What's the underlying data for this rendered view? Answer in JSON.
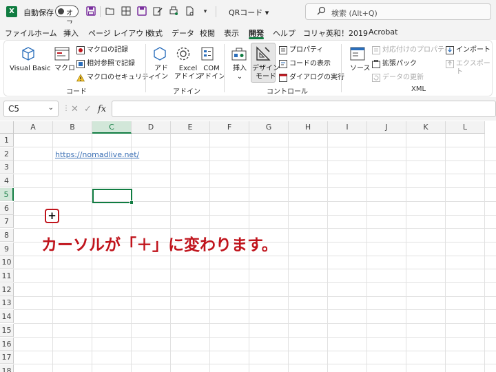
{
  "titlebar": {
    "app_logo": "X",
    "autosave_label": "自動保存",
    "autosave_state": "オフ",
    "doc_title": "QRコード ▾",
    "search_placeholder": "検索 (Alt+Q)",
    "qat_icons": [
      "save-icon",
      "open-icon",
      "table-icon",
      "save-as-icon",
      "edit-icon",
      "print-preview-icon",
      "document-icon",
      "dropdown-icon"
    ]
  },
  "tabs": [
    "ファイル",
    "ホーム",
    "挿入",
    "ページ レイアウト",
    "数式",
    "データ",
    "校閲",
    "表示",
    "開発",
    "ヘルプ",
    "コリャ英和！2019",
    "Acrobat"
  ],
  "active_tab": "開発",
  "ribbon": {
    "code": {
      "visual_basic": "Visual Basic",
      "macro": "マクロ",
      "record_macro": "マクロの記録",
      "relative_ref": "相対参照で記録",
      "macro_security": "マクロのセキュリティ",
      "label": "コード"
    },
    "addin": {
      "addin_1": "アド",
      "addin_2": "イン",
      "excel_1": "Excel",
      "excel_2": "アドイン",
      "com_1": "COM",
      "com_2": "アドイン",
      "label": "アドイン"
    },
    "controls": {
      "insert": "挿入",
      "insert_arrow": "⌄",
      "design_1": "デザイン",
      "design_2": "モード",
      "properties": "プロパティ",
      "view_code": "コードの表示",
      "run_dialog": "ダイアログの実行",
      "label": "コントロール"
    },
    "xml": {
      "source": "ソース",
      "map_properties": "対応付けのプロパティ",
      "expansion_packs": "拡張パック",
      "refresh_data": "データの更新",
      "import": "インポート",
      "export": "エクスポート",
      "label": "XML"
    }
  },
  "formula_bar": {
    "name_box": "C5",
    "name_box_arrow": "⌄",
    "cancel": "✕",
    "enter": "✓",
    "fx": "fx",
    "value": ""
  },
  "grid": {
    "columns": [
      "A",
      "B",
      "C",
      "D",
      "E",
      "F",
      "G",
      "H",
      "I",
      "J",
      "K",
      "L"
    ],
    "rows": [
      "1",
      "2",
      "3",
      "4",
      "5",
      "6",
      "7",
      "8",
      "9",
      "10",
      "11",
      "12",
      "13",
      "14",
      "15",
      "16",
      "17",
      "18"
    ],
    "selected_column": "C",
    "selected_row": "5",
    "link_text": "https://nomadlive.net/"
  },
  "annotation": {
    "plus_symbol": "+",
    "text": "カーソルが「＋」に変わります。",
    "color": "#c0141c"
  }
}
